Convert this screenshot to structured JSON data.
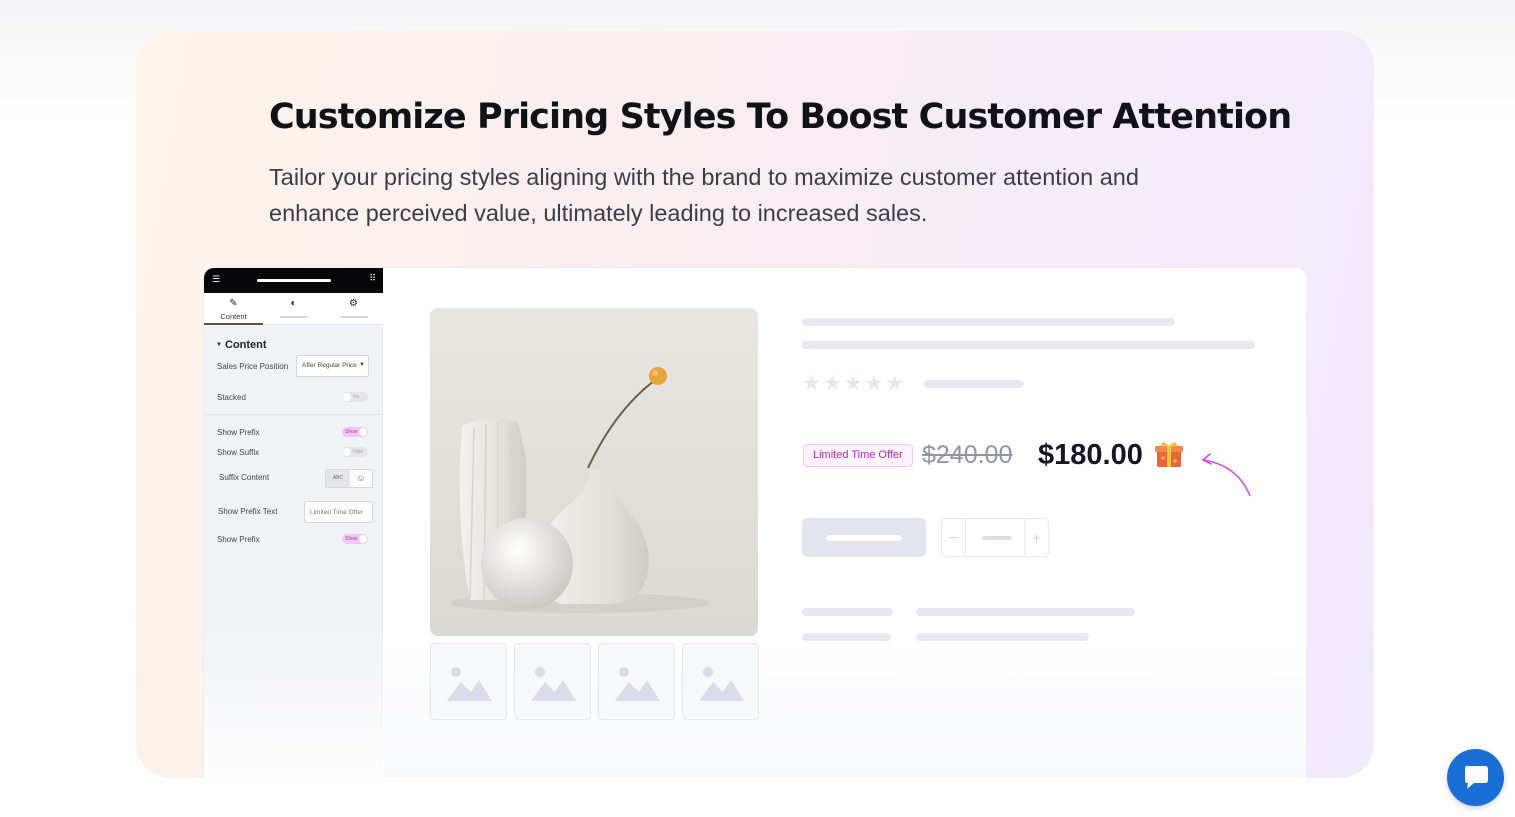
{
  "hero": {
    "title": "Customize Pricing Styles To Boost Customer Attention",
    "subtitle": "Tailor your pricing styles aligning with the brand to maximize customer attention and enhance perceived value, ultimately leading to increased sales."
  },
  "editor_panel": {
    "tabs": [
      {
        "label": "Content",
        "icon": "pencil-icon",
        "active": true
      },
      {
        "label": "",
        "icon": "contrast-icon",
        "active": false
      },
      {
        "label": "",
        "icon": "gear-icon",
        "active": false
      }
    ],
    "section_title": "Content",
    "rows": {
      "sales_price_position": {
        "label": "Sales Price Position",
        "value": "After Regular Price"
      },
      "stacked": {
        "label": "Stacked",
        "toggle": "No",
        "on": false
      },
      "show_prefix": {
        "label": "Show Prefix",
        "toggle": "Show",
        "on": true
      },
      "show_suffix": {
        "label": "Show Suffix",
        "toggle": "Hide",
        "on": false
      },
      "suffix_content": {
        "label": "Suffix Content",
        "option_text": "ABC",
        "option_icon": "smiley-icon"
      },
      "show_prefix_text": {
        "label": "Show Prefix Text",
        "value": "Limited Time Offer"
      },
      "show_prefix_2": {
        "label": "Show Prefix",
        "toggle": "Show",
        "on": true
      }
    }
  },
  "product": {
    "badge": "Limited Time Offer",
    "regular_price": "$240.00",
    "sale_price": "$180.00",
    "rating_stars": "★★★★★",
    "gift_icon": "gift-icon",
    "qty_minus": "−",
    "qty_plus": "+"
  },
  "colors": {
    "accent": "#b02fb4",
    "price": "#141628",
    "chat": "#1a6fd6"
  }
}
